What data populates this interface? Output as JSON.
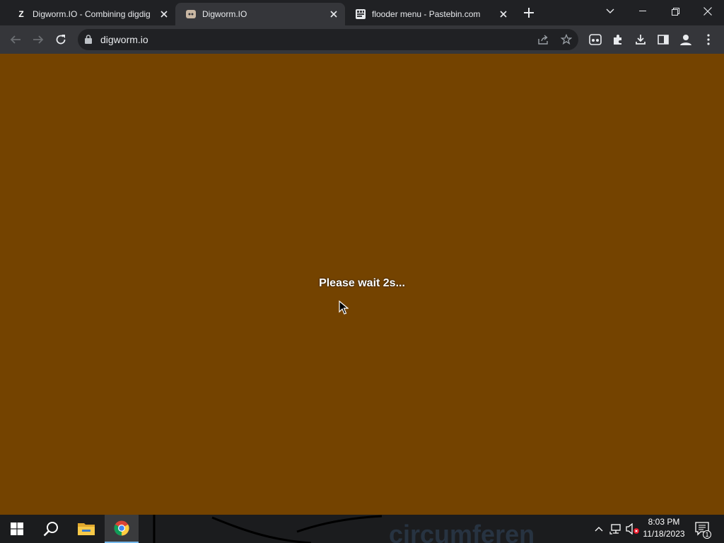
{
  "browser": {
    "tabs": [
      {
        "title": "Digworm.IO - Combining digdig",
        "favicon": "letter-z-icon",
        "favicon_text": "Z",
        "active": false
      },
      {
        "title": "Digworm.IO",
        "favicon": "digworm-icon",
        "active": true
      },
      {
        "title": "flooder menu - Pastebin.com",
        "favicon": "pastebin-icon",
        "active": false
      }
    ],
    "address_bar": {
      "url": "digworm.io"
    }
  },
  "page": {
    "background_color": "#744300",
    "message": "Please wait 2s..."
  },
  "taskbar": {
    "apps": [
      "windows-start-icon",
      "search-icon",
      "file-explorer-icon",
      "chrome-icon"
    ],
    "clock": {
      "time": "8:03 PM",
      "date": "11/18/2023"
    },
    "notification_count": "1"
  }
}
